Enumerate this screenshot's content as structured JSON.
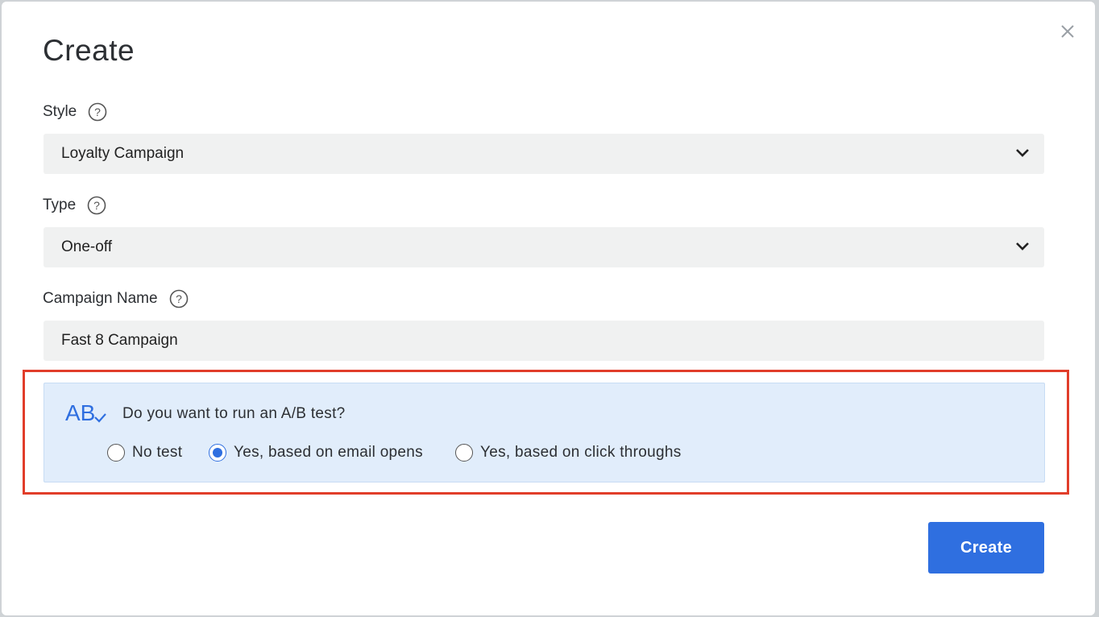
{
  "dialog": {
    "title": "Create",
    "close_icon": "close-icon"
  },
  "style_field": {
    "label": "Style",
    "help_icon": "question-circle-icon",
    "value": "Loyalty Campaign"
  },
  "type_field": {
    "label": "Type",
    "help_icon": "question-circle-icon",
    "value": "One-off"
  },
  "campaign_name_field": {
    "label": "Campaign Name",
    "help_icon": "question-circle-icon",
    "value": "Fast 8 Campaign"
  },
  "ab_test": {
    "icon": "ab-test-icon",
    "question": "Do you want to run an A/B test?",
    "options": [
      {
        "label": "No test",
        "selected": false
      },
      {
        "label": "Yes, based on email opens",
        "selected": true
      },
      {
        "label": "Yes, based on click throughs",
        "selected": false
      }
    ]
  },
  "actions": {
    "create_label": "Create"
  },
  "colors": {
    "primary": "#2f6fe0",
    "highlight_border": "#e13d2a",
    "panel_background": "#e1edfb",
    "field_background": "#f0f1f1"
  }
}
